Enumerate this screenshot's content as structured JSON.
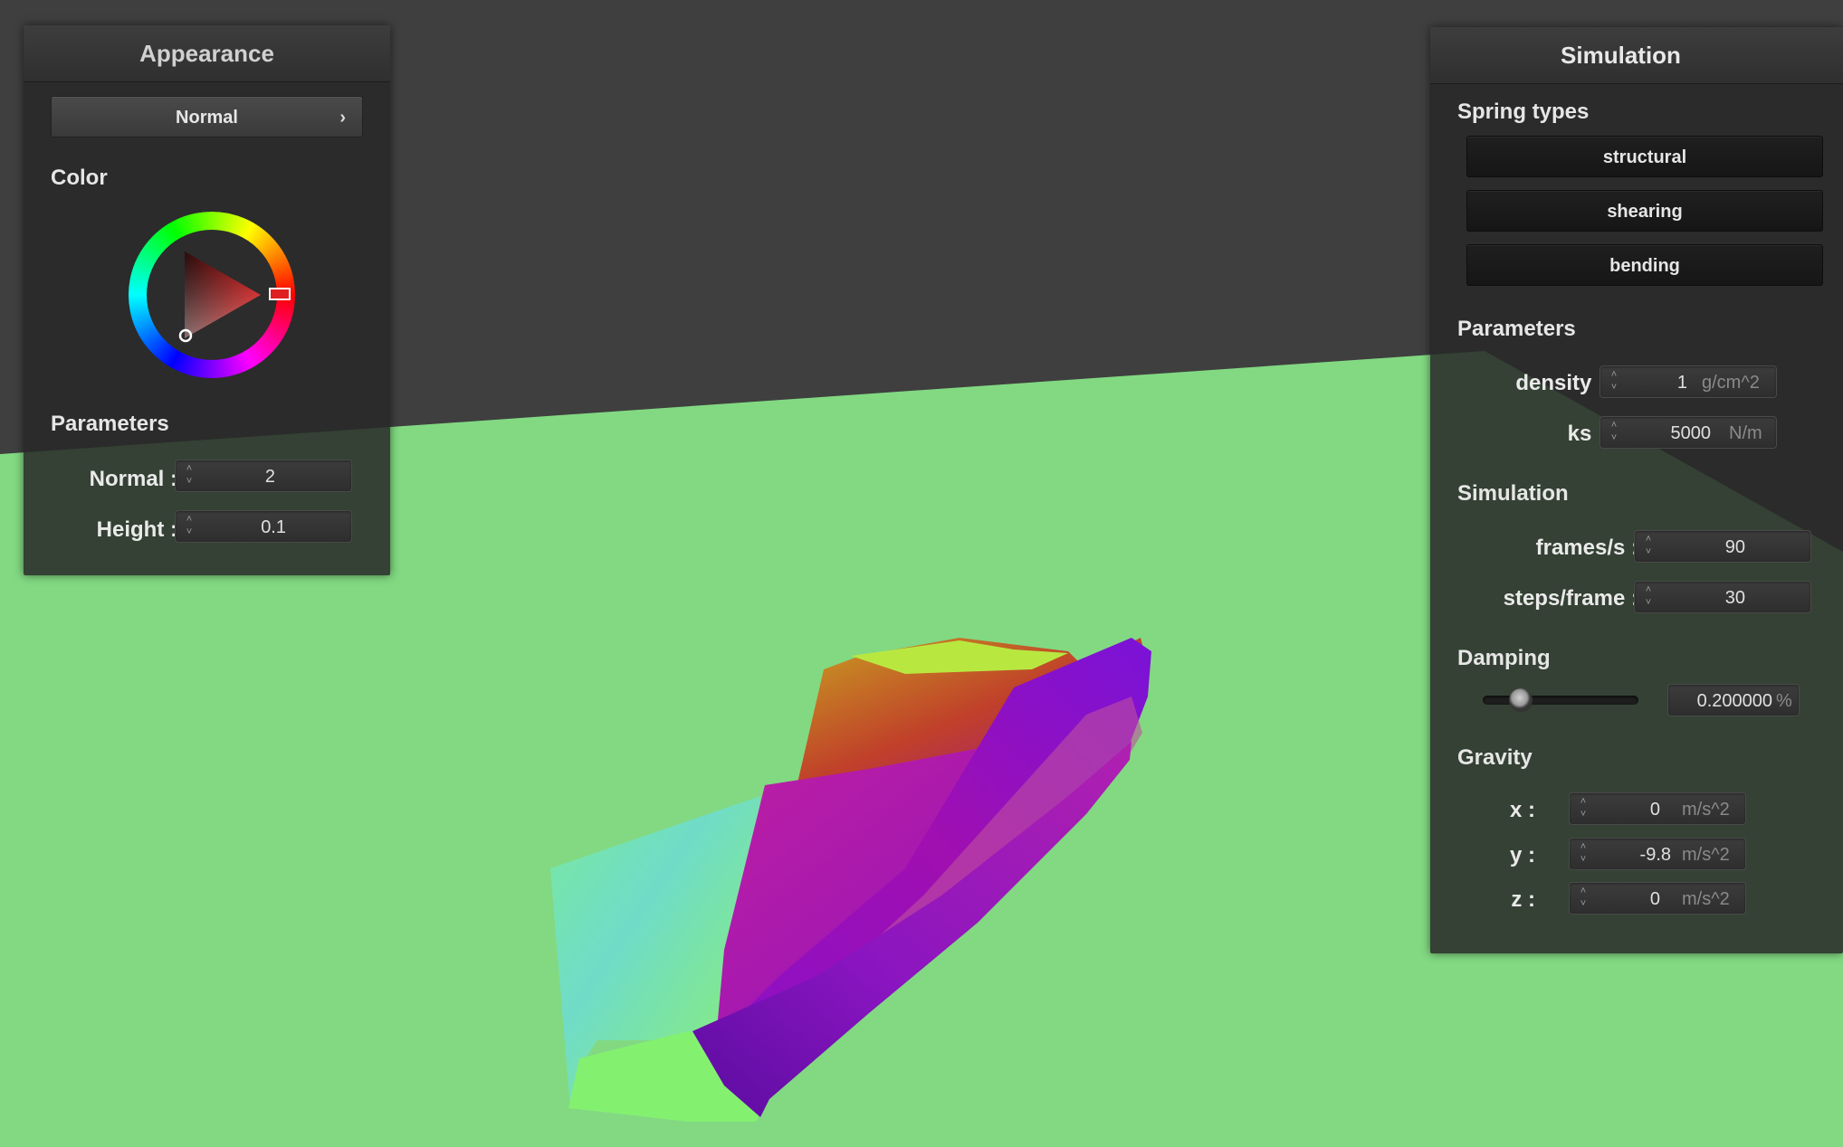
{
  "appearance": {
    "title": "Appearance",
    "mode_label": "Normal",
    "mode_chevron": "›",
    "color_section": "Color",
    "selected_color": "#e02020",
    "params_section": "Parameters",
    "normal_label": "Normal :",
    "normal_value": "2",
    "height_label": "Height :",
    "height_value": "0.1"
  },
  "simulation": {
    "title": "Simulation",
    "spring_types_section": "Spring types",
    "spring_buttons": [
      "structural",
      "shearing",
      "bending"
    ],
    "params_section": "Parameters",
    "density_label": "density :",
    "density_value": "1",
    "density_unit": "g/cm^2",
    "ks_label": "ks :",
    "ks_value": "5000",
    "ks_unit": "N/m",
    "sim_section": "Simulation",
    "fps_label": "frames/s :",
    "fps_value": "90",
    "steps_label": "steps/frame :",
    "steps_value": "30",
    "damping_section": "Damping",
    "damping_fraction": 0.2,
    "damping_value": "0.200000",
    "damping_unit": "%",
    "gravity_section": "Gravity",
    "gx_label": "x :",
    "gx_value": "0",
    "gy_label": "y :",
    "gy_value": "-9.8",
    "gz_label": "z :",
    "gz_value": "0",
    "gravity_unit": "m/s^2"
  },
  "colors": {
    "background": "#3f3f3f",
    "floor": "#82d982",
    "panel": "#282828"
  }
}
